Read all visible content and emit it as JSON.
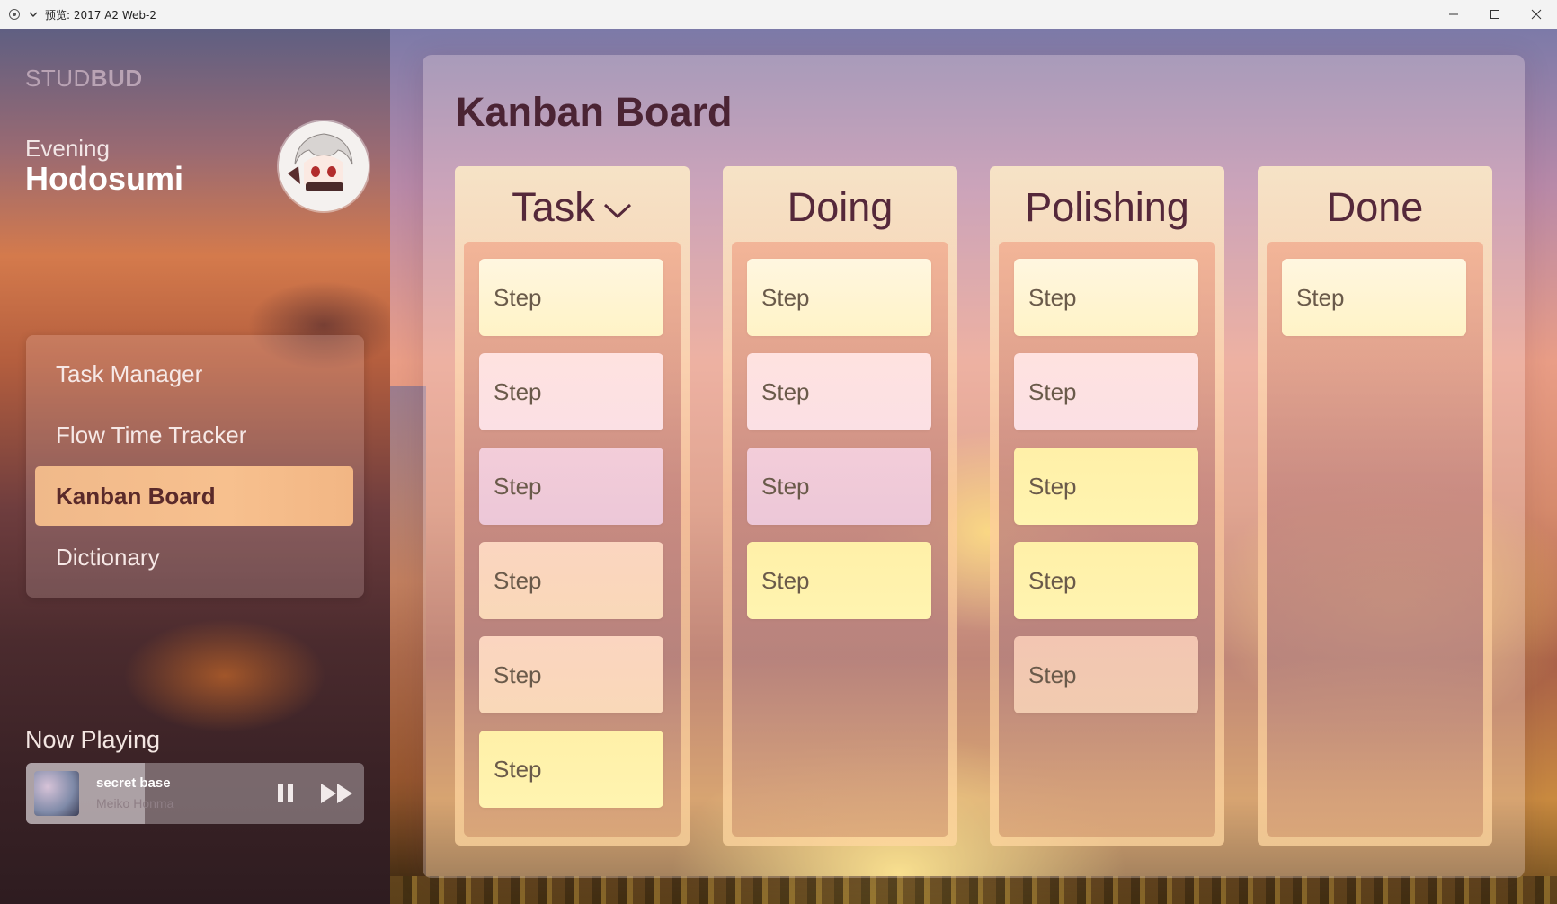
{
  "window": {
    "title": "预览: 2017 A2 Web-2"
  },
  "brand": {
    "part1": "STUD",
    "part2": "BUD"
  },
  "greeting": {
    "salutation": "Evening",
    "name": "Hodosumi"
  },
  "nav": {
    "items": [
      {
        "label": "Task Manager"
      },
      {
        "label": "Flow Time Tracker"
      },
      {
        "label": "Kanban Board",
        "active": true
      },
      {
        "label": "Dictionary"
      }
    ]
  },
  "now_playing": {
    "label": "Now Playing",
    "song": "secret base",
    "artist": "Meiko Honma",
    "progress": 0.35
  },
  "page": {
    "title": "Kanban Board"
  },
  "board": {
    "columns": [
      {
        "title": "Task",
        "has_dropdown": true,
        "cards": [
          "Step",
          "Step",
          "Step",
          "Step",
          "Step",
          "Step"
        ]
      },
      {
        "title": "Doing",
        "cards": [
          "Step",
          "Step",
          "Step",
          "Step"
        ]
      },
      {
        "title": "Polishing",
        "cards": [
          "Step",
          "Step",
          "Step",
          "Step",
          "Step"
        ]
      },
      {
        "title": "Done",
        "cards": [
          "Step"
        ]
      }
    ]
  },
  "colors": {
    "active_nav": "#f3ba89",
    "title": "#4b2434",
    "column_title": "#55283a"
  }
}
